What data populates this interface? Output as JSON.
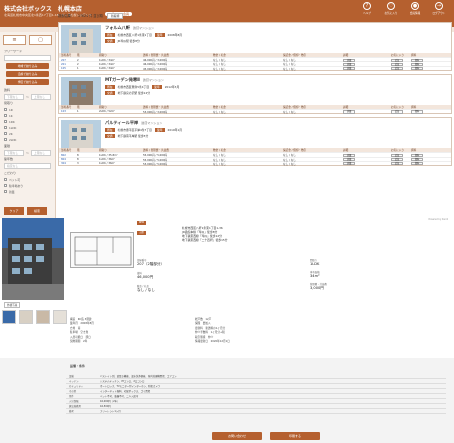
{
  "header": {
    "logo": "株式会社ボックス　札幌本店",
    "subtitle": "北海道札幌市中央区北1条西17丁目1-18　ヴィラ札幌レジデンス",
    "tag": "ログイン・会員",
    "icons": [
      {
        "name": "question-icon",
        "label": "ヘルプ",
        "glyph": "?"
      },
      {
        "name": "heart-icon",
        "label": "お気に入り",
        "glyph": "♡"
      },
      {
        "name": "user-icon",
        "label": "会員情報",
        "glyph": "●"
      },
      {
        "name": "logout-icon",
        "label": "ログアウト",
        "glyph": "→"
      }
    ]
  },
  "sidebar": {
    "keyword_label": "フリーワード",
    "keyword_placeholder": "",
    "btn_area": "地域で絞り込み",
    "btn_line": "沿線で絞り込み",
    "btn_school": "学区で絞り込み",
    "rent_label": "賃料",
    "rent_min": "下限なし",
    "rent_max": "上限なし",
    "layout_label": "間取り",
    "layout_options": [
      "1R",
      "1K",
      "1DK",
      "1LDK",
      "2K",
      "2LDK"
    ],
    "area_label": "面積",
    "area_min": "下限なし",
    "area_max": "上限なし",
    "age_label": "築年数",
    "age_value": "指定なし",
    "option_label": "こだわり",
    "option_items": [
      "ペット可",
      "駐車場あり",
      "新築"
    ],
    "clear": "クリア",
    "search": "検索"
  },
  "results": {
    "count_label": "検索結果：",
    "count": "17624 件 並び順",
    "sort": "新着順",
    "columns": [
      "部屋番号",
      "階",
      "間取り",
      "賃料 / 管理費・共益費",
      "敷金 / 礼金",
      "保証金 / 償却・敷引",
      "詳細",
      "お気に入り",
      "資料"
    ],
    "buildings": [
      {
        "name": "フォルム八軒",
        "type": "賃貸マンション",
        "address": "札幌市西区八軒1条東1丁目",
        "station": "JR琴似駅 徒歩8分",
        "built": "2008年8月",
        "rooms": [
          {
            "no": "207",
            "floor": "2",
            "layout": "1LDK / 34m²",
            "rent": "46,000円 / 3,000円",
            "deposit": "なし / なし",
            "guarantee": "なし / なし"
          },
          {
            "no": "201",
            "floor": "2",
            "layout": "1LDK / 34m²",
            "rent": "46,000円 / 3,000円",
            "deposit": "なし / なし",
            "guarantee": "なし / なし"
          },
          {
            "no": "105",
            "floor": "1",
            "layout": "1LDK / 34m²",
            "rent": "45,000円 / 3,000円",
            "deposit": "なし / なし",
            "guarantee": "なし / なし"
          }
        ]
      },
      {
        "name": "MTガーデン発寒Ⅱ",
        "type": "賃貸マンション",
        "address": "札幌市西区発寒5条4丁目",
        "station": "地下鉄宮の沢駅 徒歩12分",
        "built": "2012年3月",
        "rooms": [
          {
            "no": "103",
            "floor": "1",
            "layout": "2LDK / 52m²",
            "rent": "53,000円 / 3,000円",
            "deposit": "なし / なし",
            "guarantee": "なし / なし"
          }
        ]
      },
      {
        "name": "パルティール平岸",
        "type": "賃貸マンション",
        "address": "札幌市豊平区平岸4条7丁目",
        "station": "地下鉄南平岸駅 徒歩5分",
        "built": "2019年1月",
        "rooms": [
          {
            "no": "802",
            "floor": "8",
            "layout": "1LDK / 35.8m²",
            "rent": "55,000円 / 5,000円",
            "deposit": "なし / なし",
            "guarantee": "なし / なし"
          },
          {
            "no": "804",
            "floor": "8",
            "layout": "1LDK / 36m²",
            "rent": "55,000円 / 5,000円",
            "deposit": "なし / なし",
            "guarantee": "なし / なし"
          },
          {
            "no": "304",
            "floor": "3",
            "layout": "1LDK / 36m²",
            "rent": "53,000円 / 5,000円",
            "deposit": "なし / なし",
            "guarantee": "なし / なし"
          }
        ]
      }
    ],
    "btn_detail": "詳細",
    "btn_fav": "追加",
    "btn_doc": "資料"
  },
  "detail": {
    "powered": "Powered by itandi",
    "photo_caption": "外観写真",
    "floorplan": "間取り図",
    "chip_new": "NEW",
    "chip_pub": "公開",
    "address_lines": [
      "札幌市西区八軒1条東1丁目1-36",
      "JR函館本線「琴似」徒歩8分",
      "地下鉄東西線「琴似」徒歩12分",
      "地下鉄東西線「二十四軒」徒歩15分"
    ],
    "room_label": "部屋番号",
    "room_value": "207（2階部分）",
    "rent_label": "賃料",
    "rent_value": "46,000円",
    "fee_label": "管理費・共益費",
    "fee_value": "3,000円",
    "layout_label": "間取り",
    "layout_value": "1LDK",
    "area_label": "専有面積",
    "area_value": "34m²",
    "deposit_label": "敷金 / 礼金",
    "deposit_value": "なし / なし",
    "specs_left": [
      "構造　RC造 3階建",
      "築年月　2008年8月",
      "方角　南",
      "駐車場　空き無",
      "入居可能日　即日",
      "契約期間　2年"
    ],
    "specs_right": [
      "総戸数　12戸",
      "保険　要加入",
      "更新料　新賃料の1ヶ月分",
      "仲介手数料　1ヶ月分+税",
      "取引態様　仲介",
      "情報更新日　2020年12月1日"
    ],
    "section_title": "設備・条件",
    "table": [
      {
        "h": "設備",
        "v": "バストイレ別、追焚き機能、温水洗浄便座、室内洗濯機置場、エアコン"
      },
      {
        "h": "キッチン",
        "v": "システムキッチン、IHコンロ、2口コンロ"
      },
      {
        "h": "セキュリティ",
        "v": "オートロック、TVモニター付インターホン、防犯カメラ"
      },
      {
        "h": "その他",
        "v": "インターネット無料、宅配ボックス、ゴミ置場"
      },
      {
        "h": "条件",
        "v": "ペット不可、楽器不可、二人入居可"
      },
      {
        "h": "火災保険",
        "v": "16,000円（2年）"
      },
      {
        "h": "鍵交換費用",
        "v": "16,500円"
      },
      {
        "h": "備考",
        "v": "フリーレント1ヶ月"
      }
    ],
    "btn_apply": "お問い合わせ",
    "btn_print": "印刷する"
  },
  "colors": {
    "brand": "#b5602f",
    "brand_light": "#f3e6dc"
  }
}
